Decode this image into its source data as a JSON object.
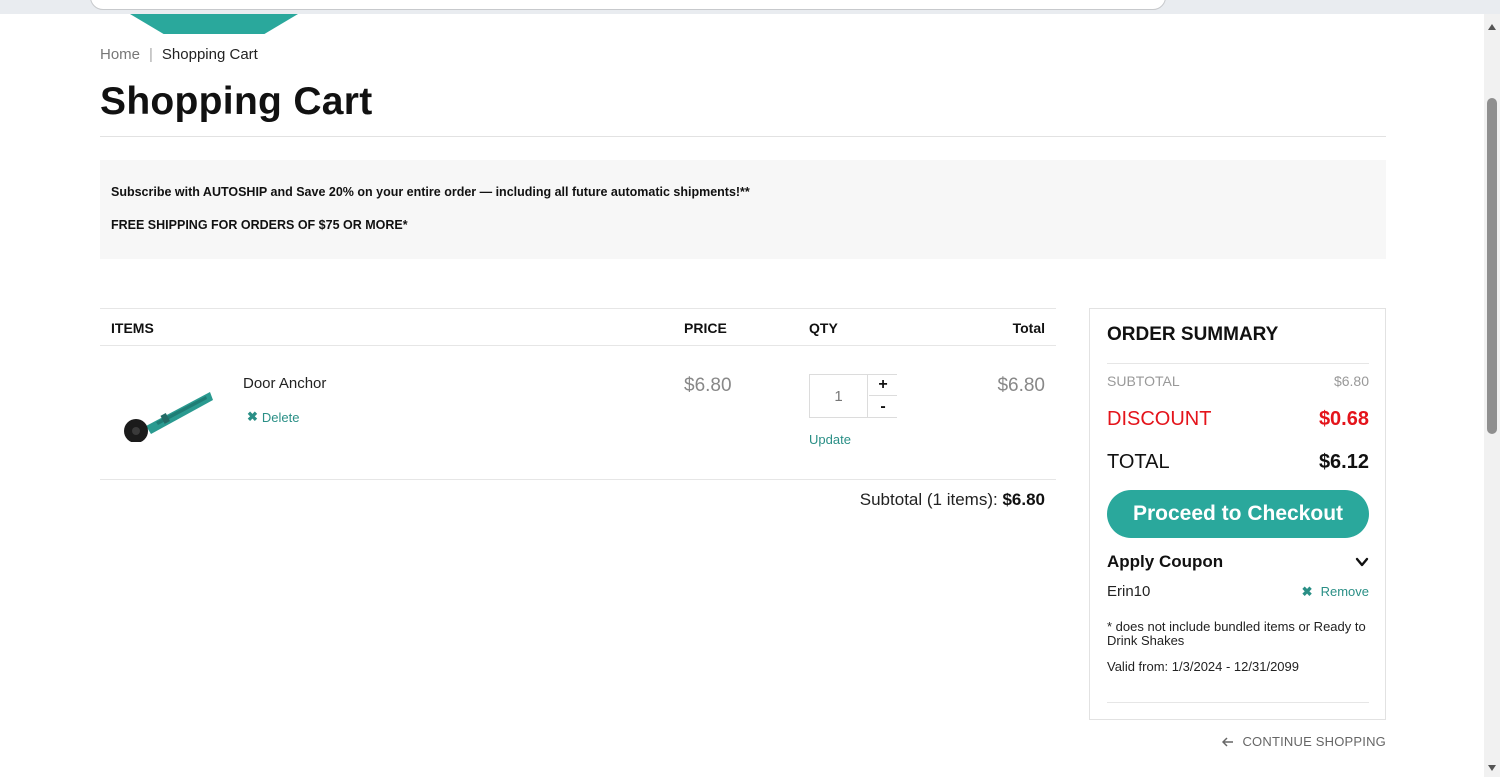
{
  "breadcrumb": {
    "home": "Home",
    "separator": "|",
    "current": "Shopping Cart"
  },
  "page_title": "Shopping Cart",
  "promo": {
    "line1": "Subscribe with AUTOSHIP and Save 20% on your entire order — including all future automatic shipments!**",
    "line2": "FREE SHIPPING FOR ORDERS OF $75 OR MORE*"
  },
  "cart": {
    "headers": {
      "items": "ITEMS",
      "price": "PRICE",
      "qty": "QTY",
      "total": "Total"
    },
    "items": [
      {
        "name": "Door Anchor",
        "delete_label": "Delete",
        "price": "$6.80",
        "quantity": "1",
        "plus": "+",
        "minus": "-",
        "update_label": "Update",
        "total": "$6.80"
      }
    ],
    "subtotal_label": "Subtotal (1 items):",
    "subtotal_value": "$6.80"
  },
  "summary": {
    "title": "ORDER SUMMARY",
    "subtotal_label": "SUBTOTAL",
    "subtotal_value": "$6.80",
    "discount_label": "DISCOUNT",
    "discount_value": "$0.68",
    "total_label": "TOTAL",
    "total_value": "$6.12",
    "checkout_label": "Proceed to Checkout",
    "coupon_heading": "Apply Coupon",
    "coupon_code": "Erin10",
    "remove_label": "Remove",
    "coupon_note": "* does not include bundled items or Ready to Drink Shakes",
    "coupon_valid": "Valid from: 1/3/2024 - 12/31/2099"
  },
  "continue_label": "CONTINUE SHOPPING",
  "colors": {
    "accent": "#2aa89c",
    "link": "#2a8f86",
    "discount": "#e4141b",
    "promo_bg": "#f7f7f7"
  },
  "icons": {
    "delete": "x-icon",
    "remove": "x-icon",
    "coupon_toggle": "chevron-down-icon",
    "continue": "arrow-left-icon"
  }
}
